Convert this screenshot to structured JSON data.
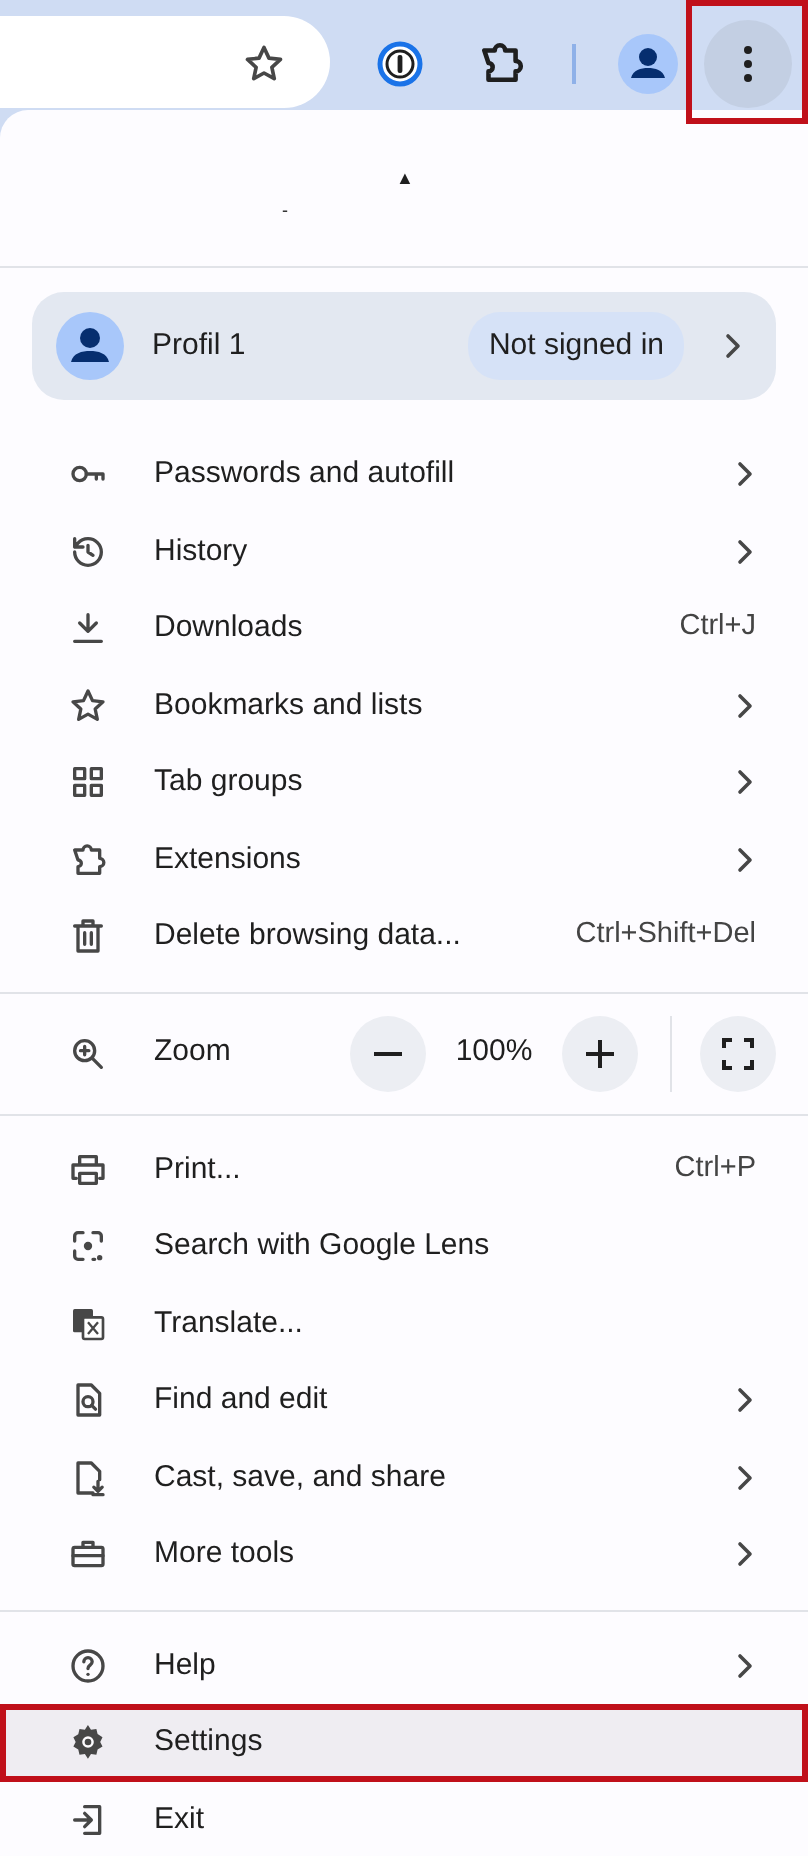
{
  "toolbar": {
    "menu_button_highlighted": true
  },
  "menu": {
    "marks": [
      "▲",
      "-"
    ],
    "profile": {
      "name": "Profil 1",
      "status": "Not signed in"
    },
    "group_1": [
      {
        "label": "Passwords and autofill",
        "kind": "submenu",
        "highlighted": false
      },
      {
        "label": "History",
        "kind": "submenu",
        "highlighted": false
      },
      {
        "label": "Downloads",
        "kind": "shortcut",
        "shortcut": "Ctrl+J",
        "highlighted": false
      },
      {
        "label": "Bookmarks and lists",
        "kind": "submenu",
        "highlighted": false
      },
      {
        "label": "Tab groups",
        "kind": "submenu",
        "highlighted": false
      },
      {
        "label": "Extensions",
        "kind": "submenu",
        "highlighted": false
      },
      {
        "label": "Delete browsing data...",
        "kind": "shortcut",
        "shortcut": "Ctrl+Shift+Del",
        "highlighted": false
      }
    ],
    "zoom": {
      "label": "Zoom",
      "value": "100%"
    },
    "group_2": [
      {
        "label": "Print...",
        "kind": "shortcut",
        "shortcut": "Ctrl+P",
        "highlighted": false
      },
      {
        "label": "Search with Google Lens",
        "kind": "plain",
        "highlighted": false
      },
      {
        "label": "Translate...",
        "kind": "plain",
        "highlighted": false
      },
      {
        "label": "Find and edit",
        "kind": "submenu",
        "highlighted": false
      },
      {
        "label": "Cast, save, and share",
        "kind": "submenu",
        "highlighted": false
      },
      {
        "label": "More tools",
        "kind": "submenu",
        "highlighted": false
      }
    ],
    "group_3": [
      {
        "label": "Help",
        "kind": "submenu",
        "highlighted": false
      },
      {
        "label": "Settings",
        "kind": "plain",
        "highlighted": true
      },
      {
        "label": "Exit",
        "kind": "plain",
        "highlighted": false
      }
    ]
  }
}
